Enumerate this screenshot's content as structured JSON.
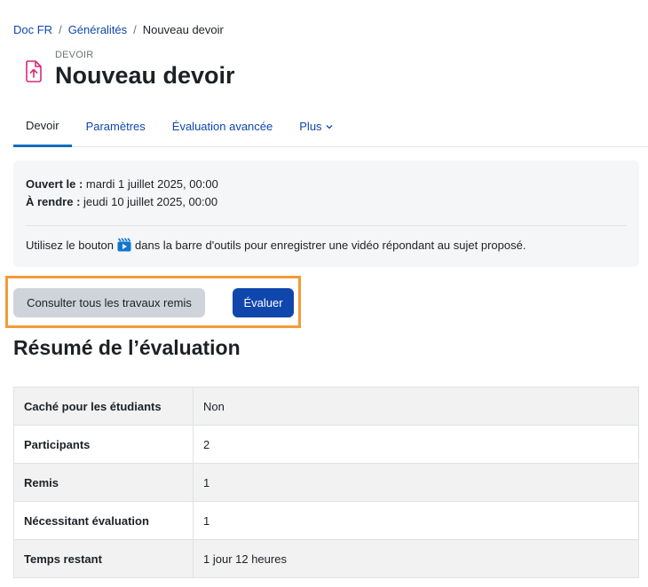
{
  "breadcrumb": {
    "items": [
      "Doc FR",
      "Généralités"
    ],
    "current": "Nouveau devoir"
  },
  "header": {
    "modtype": "DEVOIR",
    "title": "Nouveau devoir",
    "icon": "assignment-upload-icon"
  },
  "tabs": [
    {
      "label": "Devoir",
      "active": true
    },
    {
      "label": "Paramètres",
      "active": false
    },
    {
      "label": "Évaluation avancée",
      "active": false
    },
    {
      "label": "Plus",
      "active": false,
      "has_dropdown": true
    }
  ],
  "dates": {
    "opened_label": "Ouvert le :",
    "opened_value": "mardi 1 juillet 2025, 00:00",
    "due_label": "À rendre :",
    "due_value": "jeudi 10 juillet 2025, 00:00"
  },
  "intro": {
    "before": "Utilisez le bouton",
    "after": "dans la barre d'outils pour enregistrer une vidéo répondant au sujet proposé.",
    "icon": "video-record-icon"
  },
  "actions": {
    "view_all": "Consulter tous les travaux remis",
    "grade": "Évaluer"
  },
  "summary": {
    "heading": "Résumé de l’évaluation",
    "rows": [
      {
        "label": "Caché pour les étudiants",
        "value": "Non"
      },
      {
        "label": "Participants",
        "value": "2"
      },
      {
        "label": "Remis",
        "value": "1"
      },
      {
        "label": "Nécessitant évaluation",
        "value": "1"
      },
      {
        "label": "Temps restant",
        "value": "1 jour 12 heures"
      }
    ]
  },
  "colors": {
    "link": "#0f47ad",
    "primary": "#0f47ad",
    "highlight": "#f39a37",
    "icon_accent": "#d8287a"
  }
}
